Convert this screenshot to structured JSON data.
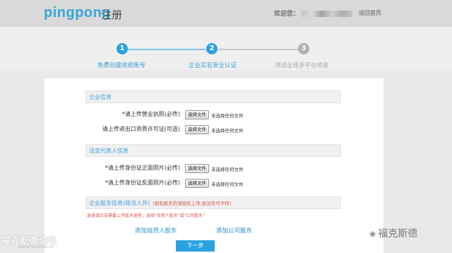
{
  "header": {
    "logo": "pingpong",
    "title": "注册",
    "welcome": "欢迎您：",
    "home_link": "返回首页"
  },
  "steps": [
    {
      "number": "1",
      "label": "免费创建收款账号",
      "state": "done"
    },
    {
      "number": "2",
      "label": "企业实名安全认证",
      "state": "active"
    },
    {
      "number": "3",
      "label": "测试全球多平台收款",
      "state": "pending"
    }
  ],
  "sections": {
    "company_info": {
      "title": "企业信息",
      "rows": [
        {
          "label": "*请上传营业执照(必传)",
          "button": "选择文件",
          "status": "未选择任何文件"
        },
        {
          "label": "请上传进出口资质许可证(可选)",
          "button": "选择文件",
          "status": "未选择任何文件"
        }
      ]
    },
    "legal_rep": {
      "title": "法定代表人信息",
      "rows": [
        {
          "label": "*请上传身份证正面照片(必传)",
          "button": "选择文件",
          "status": "未选择任何文件"
        },
        {
          "label": "*请上传身份证反面照片(必传)",
          "button": "选择文件",
          "status": "未选择任何文件"
        }
      ]
    },
    "shareholders": {
      "title": "企业股东信息(除法人外)",
      "note": "(如有股东的请如实上传,如没有可不传)",
      "hint": "选择请点击需要上传股东类型，选择\"自然人股东\"或\"公司股东\"",
      "add_natural": "添加自然人股东",
      "add_company": "添加公司股东"
    }
  },
  "next_button": "下一步",
  "watermark": {
    "left": "福克斯德论坛",
    "left_sub": "www.faxsclub.cn",
    "right": "福克斯德"
  },
  "colors": {
    "accent": "#29a3de",
    "header_bg": "#d9d9d9",
    "warning": "#d9534f"
  }
}
